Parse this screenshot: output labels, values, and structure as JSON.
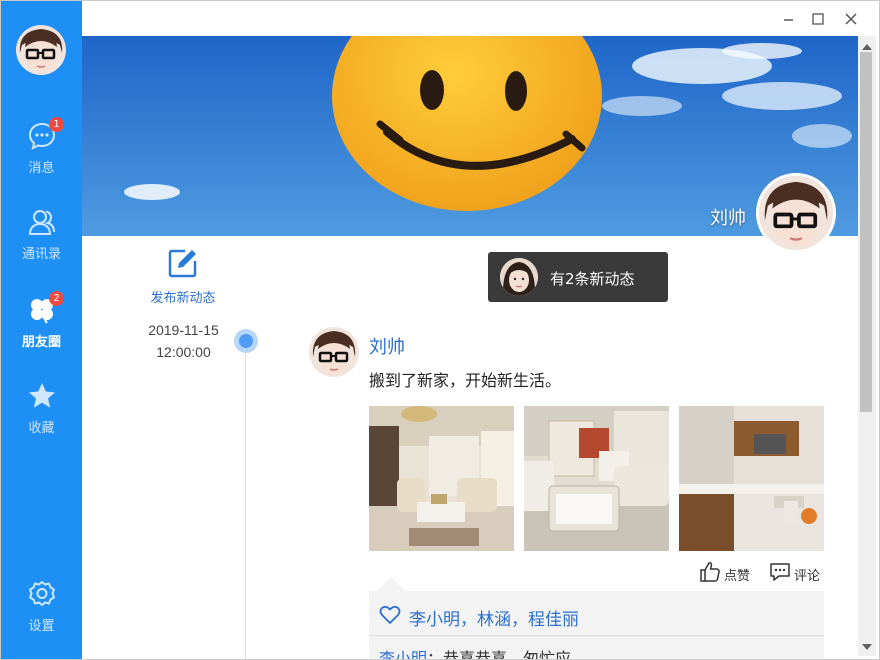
{
  "sidebar": {
    "items": [
      {
        "label": "消息",
        "icon": "chat-icon",
        "badge": "1"
      },
      {
        "label": "通讯录",
        "icon": "contacts-icon",
        "badge": ""
      },
      {
        "label": "朋友圈",
        "icon": "clover-icon",
        "badge": "2",
        "active": true
      },
      {
        "label": "收藏",
        "icon": "star-icon",
        "badge": ""
      },
      {
        "label": "设置",
        "icon": "gear-icon",
        "badge": ""
      }
    ],
    "color": "#1e8ff4"
  },
  "window_controls": {
    "minimize": "–",
    "maximize": "□",
    "close": "×"
  },
  "banner": {
    "name": "刘帅"
  },
  "timeline": {
    "publish_label": "发布新动态",
    "date": "2019-11-15",
    "time": "12:00:00"
  },
  "toast": {
    "text": "有2条新动态"
  },
  "post": {
    "author": "刘帅",
    "text": "搬到了新家，开始新生活。",
    "photos": [
      "living-room",
      "dining-room",
      "kitchen"
    ],
    "like_label": "点赞",
    "comment_label": "评论",
    "likes": "李小明，林涵，程佳丽",
    "comment": {
      "author": "李小明",
      "text": "：恭喜恭喜，匆忙应"
    }
  },
  "accent": "#2b6fcf"
}
